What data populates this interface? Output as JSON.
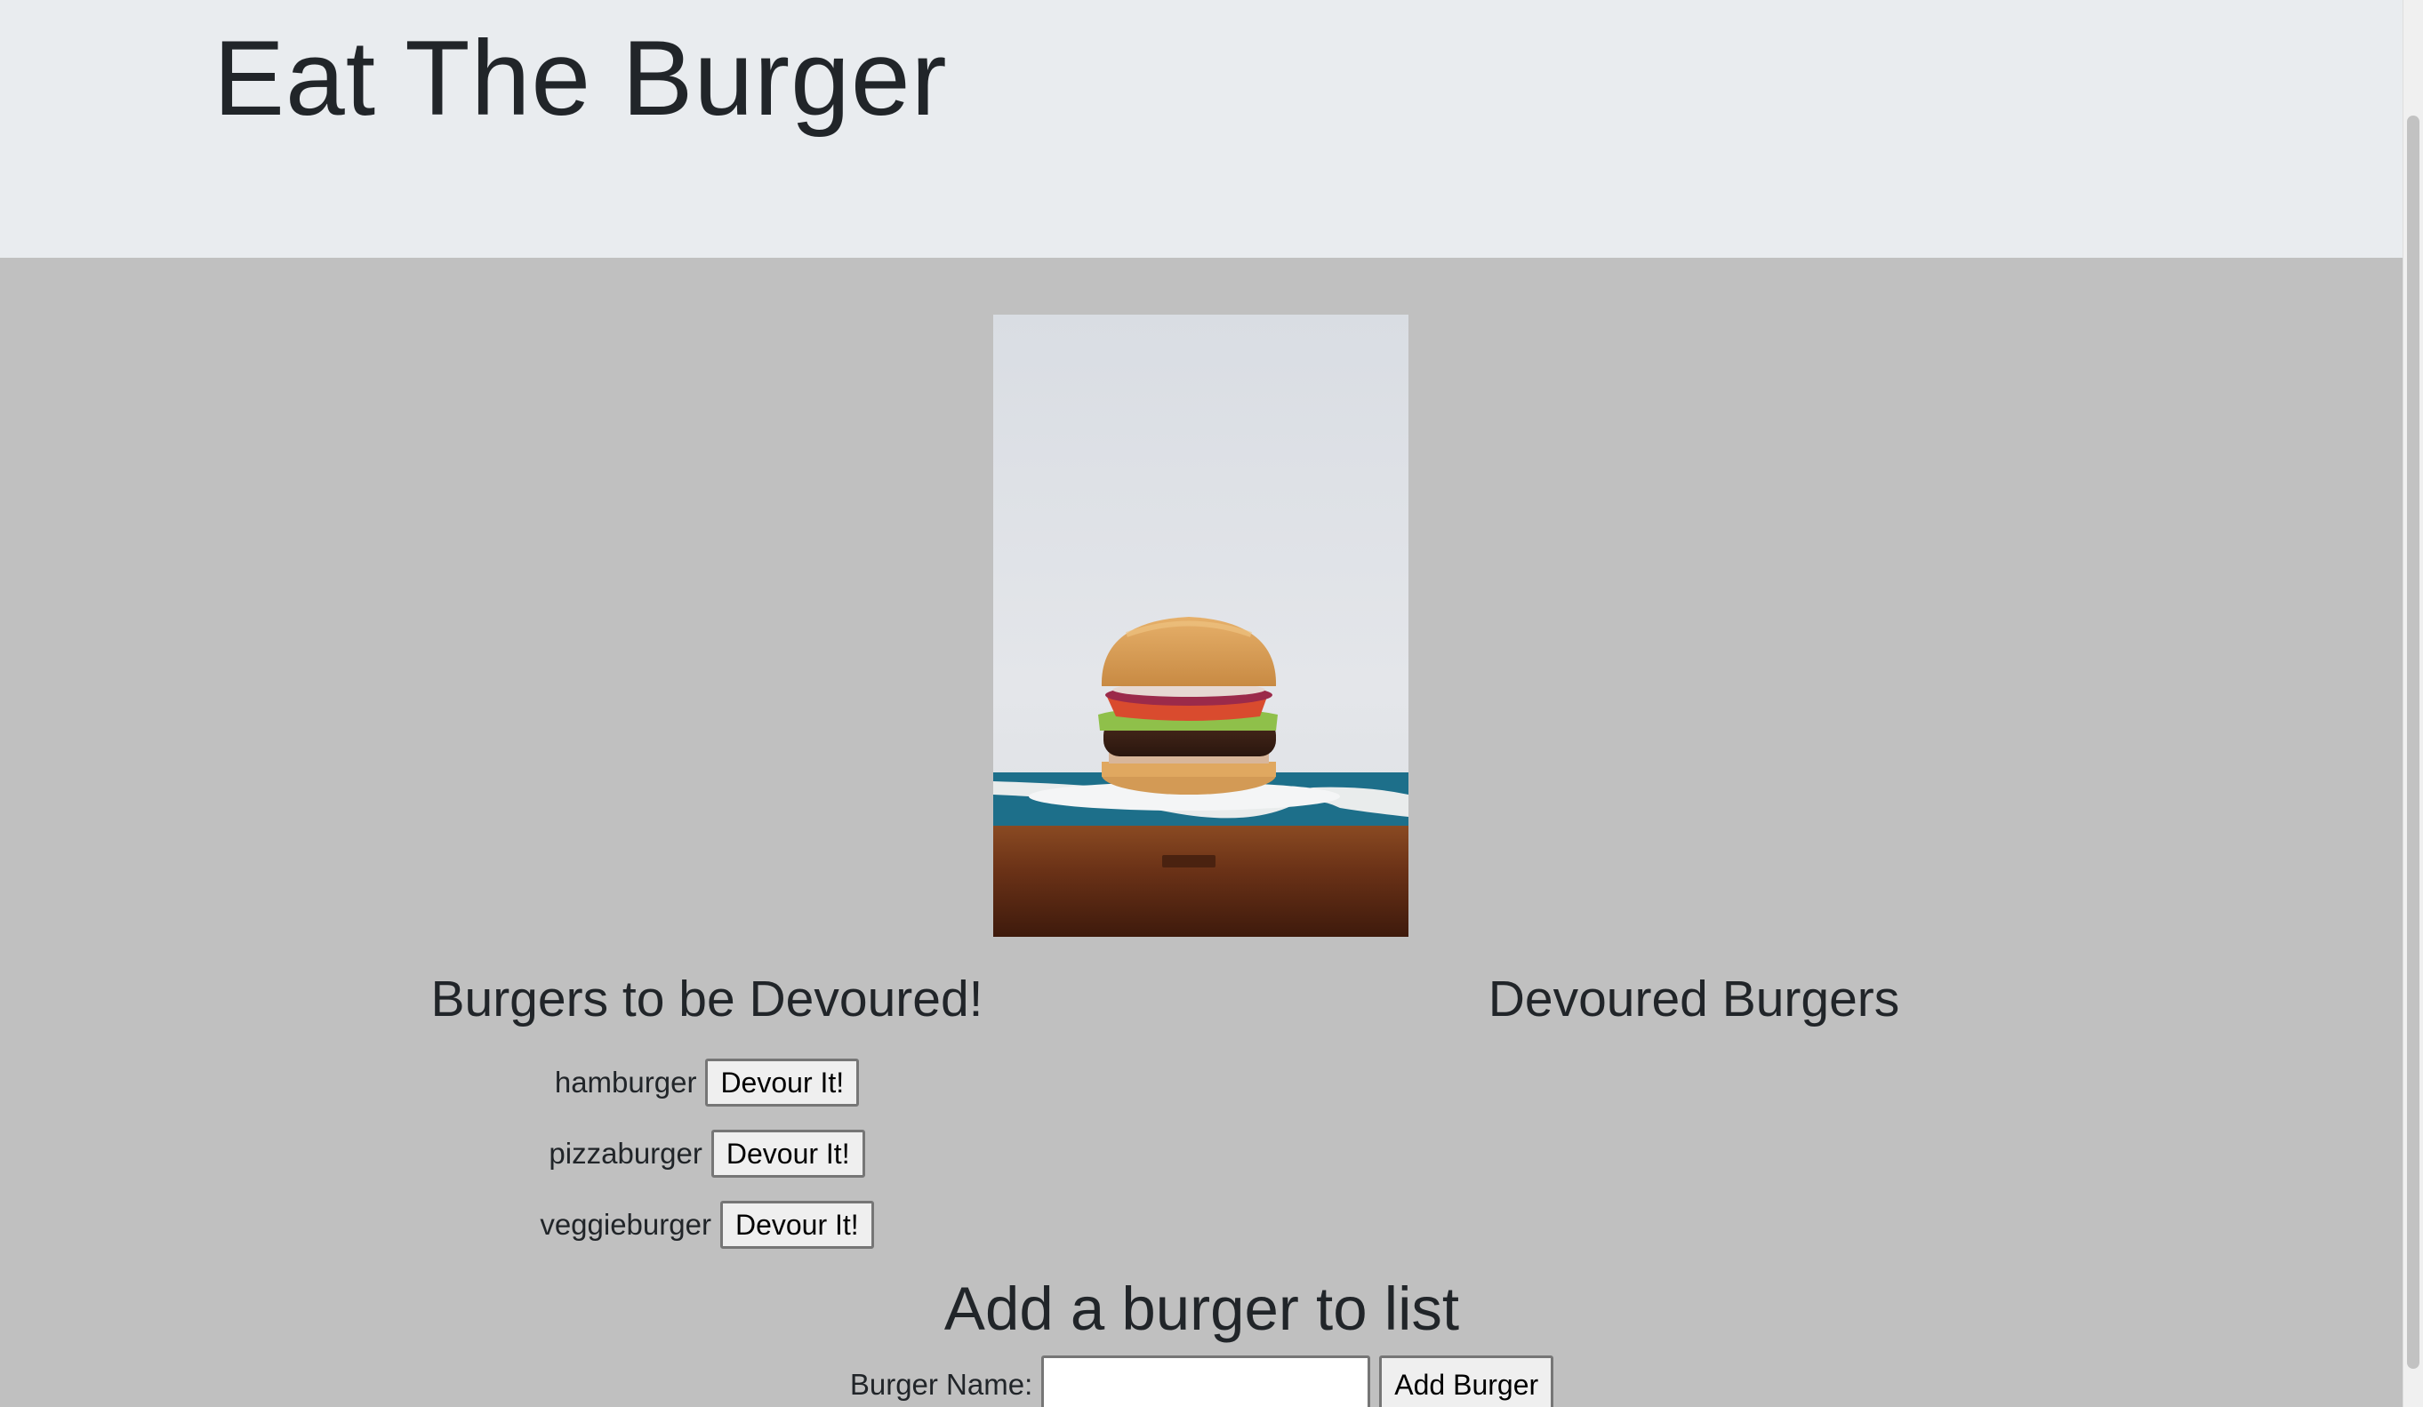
{
  "header": {
    "title": "Eat The Burger"
  },
  "hero_image": {
    "subject": "burger-photo"
  },
  "columns": {
    "to_devour_heading": "Burgers to be Devoured!",
    "devoured_heading": "Devoured Burgers"
  },
  "burgers_to_devour": [
    {
      "name": "hamburger",
      "button_label": "Devour It!"
    },
    {
      "name": "pizzaburger",
      "button_label": "Devour It!"
    },
    {
      "name": "veggieburger",
      "button_label": "Devour It!"
    }
  ],
  "devoured_burgers": [],
  "add_form": {
    "heading": "Add a burger to list",
    "label": "Burger Name:",
    "input_value": "",
    "submit_label": "Add Burger"
  },
  "colors": {
    "header_bg": "#e9ecef",
    "page_bg": "#c0c0c0",
    "text": "#212529"
  }
}
